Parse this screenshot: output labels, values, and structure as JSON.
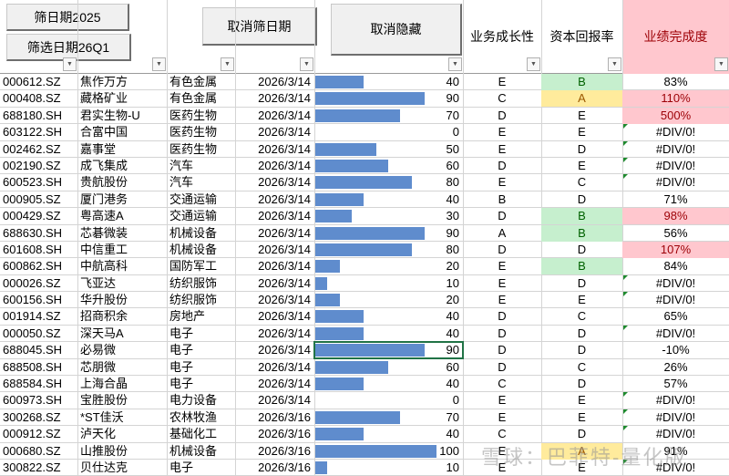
{
  "buttons": {
    "filter_2025": "筛日期2025",
    "filter_26q1": "筛选日期26Q1",
    "cancel_filter": "取消筛日期",
    "unhide": "取消隐藏"
  },
  "headers": {
    "growth": "业务成长性",
    "roe": "资本回报率",
    "completion": "业绩完成度"
  },
  "colors": {
    "bar": "#5f8ccd",
    "good_fill": "#c6efce",
    "good_text": "#006100",
    "neutral_fill": "#ffeb9c",
    "neutral_text": "#9c5700",
    "bad_fill": "#ffc7ce",
    "bad_text": "#9c0006"
  },
  "bar_max": 100,
  "rows": [
    {
      "code": "000612.SZ",
      "name": "焦作万方",
      "industry": "有色金属",
      "date": "2026/3/14",
      "score": 40,
      "growth": "E",
      "roe": "B",
      "roe_style": "good",
      "completion": "83%",
      "comp_style": ""
    },
    {
      "code": "000408.SZ",
      "name": "藏格矿业",
      "industry": "有色金属",
      "date": "2026/3/14",
      "score": 90,
      "growth": "C",
      "roe": "A",
      "roe_style": "neutral",
      "completion": "110%",
      "comp_style": "bad"
    },
    {
      "code": "688180.SH",
      "name": "君实生物-U",
      "industry": "医药生物",
      "date": "2026/3/14",
      "score": 70,
      "growth": "D",
      "roe": "E",
      "roe_style": "",
      "completion": "500%",
      "comp_style": "bad"
    },
    {
      "code": "603122.SH",
      "name": "合富中国",
      "industry": "医药生物",
      "date": "2026/3/14",
      "score": 0,
      "growth": "E",
      "roe": "E",
      "roe_style": "",
      "completion": "#DIV/0!",
      "comp_style": ""
    },
    {
      "code": "002462.SZ",
      "name": "嘉事堂",
      "industry": "医药生物",
      "date": "2026/3/14",
      "score": 50,
      "growth": "E",
      "roe": "D",
      "roe_style": "",
      "completion": "#DIV/0!",
      "comp_style": ""
    },
    {
      "code": "002190.SZ",
      "name": "成飞集成",
      "industry": "汽车",
      "date": "2026/3/14",
      "score": 60,
      "growth": "D",
      "roe": "E",
      "roe_style": "",
      "completion": "#DIV/0!",
      "comp_style": ""
    },
    {
      "code": "600523.SH",
      "name": "贵航股份",
      "industry": "汽车",
      "date": "2026/3/14",
      "score": 80,
      "growth": "E",
      "roe": "C",
      "roe_style": "",
      "completion": "#DIV/0!",
      "comp_style": ""
    },
    {
      "code": "000905.SZ",
      "name": "厦门港务",
      "industry": "交通运输",
      "date": "2026/3/14",
      "score": 40,
      "growth": "B",
      "roe": "D",
      "roe_style": "",
      "completion": "71%",
      "comp_style": ""
    },
    {
      "code": "000429.SZ",
      "name": "粤高速A",
      "industry": "交通运输",
      "date": "2026/3/14",
      "score": 30,
      "growth": "D",
      "roe": "B",
      "roe_style": "good",
      "completion": "98%",
      "comp_style": "bad"
    },
    {
      "code": "688630.SH",
      "name": "芯碁微装",
      "industry": "机械设备",
      "date": "2026/3/14",
      "score": 90,
      "growth": "A",
      "roe": "B",
      "roe_style": "good",
      "completion": "56%",
      "comp_style": ""
    },
    {
      "code": "601608.SH",
      "name": "中信重工",
      "industry": "机械设备",
      "date": "2026/3/14",
      "score": 80,
      "growth": "D",
      "roe": "D",
      "roe_style": "",
      "completion": "107%",
      "comp_style": "bad"
    },
    {
      "code": "600862.SH",
      "name": "中航高科",
      "industry": "国防军工",
      "date": "2026/3/14",
      "score": 20,
      "growth": "E",
      "roe": "B",
      "roe_style": "good",
      "completion": "84%",
      "comp_style": ""
    },
    {
      "code": "000026.SZ",
      "name": "飞亚达",
      "industry": "纺织服饰",
      "date": "2026/3/14",
      "score": 10,
      "growth": "E",
      "roe": "D",
      "roe_style": "",
      "completion": "#DIV/0!",
      "comp_style": ""
    },
    {
      "code": "600156.SH",
      "name": "华升股份",
      "industry": "纺织服饰",
      "date": "2026/3/14",
      "score": 20,
      "growth": "E",
      "roe": "E",
      "roe_style": "",
      "completion": "#DIV/0!",
      "comp_style": ""
    },
    {
      "code": "001914.SZ",
      "name": "招商积余",
      "industry": "房地产",
      "date": "2026/3/14",
      "score": 40,
      "growth": "D",
      "roe": "C",
      "roe_style": "",
      "completion": "65%",
      "comp_style": ""
    },
    {
      "code": "000050.SZ",
      "name": "深天马A",
      "industry": "电子",
      "date": "2026/3/14",
      "score": 40,
      "growth": "D",
      "roe": "D",
      "roe_style": "",
      "completion": "#DIV/0!",
      "comp_style": ""
    },
    {
      "code": "688045.SH",
      "name": "必易微",
      "industry": "电子",
      "date": "2026/3/14",
      "score": 90,
      "growth": "D",
      "roe": "D",
      "roe_style": "",
      "completion": "-10%",
      "comp_style": ""
    },
    {
      "code": "688508.SH",
      "name": "芯朋微",
      "industry": "电子",
      "date": "2026/3/14",
      "score": 60,
      "growth": "D",
      "roe": "C",
      "roe_style": "",
      "completion": "26%",
      "comp_style": ""
    },
    {
      "code": "688584.SH",
      "name": "上海合晶",
      "industry": "电子",
      "date": "2026/3/14",
      "score": 40,
      "growth": "C",
      "roe": "D",
      "roe_style": "",
      "completion": "57%",
      "comp_style": ""
    },
    {
      "code": "600973.SH",
      "name": "宝胜股份",
      "industry": "电力设备",
      "date": "2026/3/14",
      "score": 0,
      "growth": "E",
      "roe": "E",
      "roe_style": "",
      "completion": "#DIV/0!",
      "comp_style": ""
    },
    {
      "code": "300268.SZ",
      "name": "*ST佳沃",
      "industry": "农林牧渔",
      "date": "2026/3/16",
      "score": 70,
      "growth": "E",
      "roe": "E",
      "roe_style": "",
      "completion": "#DIV/0!",
      "comp_style": ""
    },
    {
      "code": "000912.SZ",
      "name": "泸天化",
      "industry": "基础化工",
      "date": "2026/3/16",
      "score": 40,
      "growth": "C",
      "roe": "D",
      "roe_style": "",
      "completion": "#DIV/0!",
      "comp_style": ""
    },
    {
      "code": "000680.SZ",
      "name": "山推股份",
      "industry": "机械设备",
      "date": "2026/3/16",
      "score": 100,
      "growth": "E",
      "roe": "A",
      "roe_style": "neutral",
      "completion": "91%",
      "comp_style": ""
    },
    {
      "code": "300822.SZ",
      "name": "贝仕达克",
      "industry": "电子",
      "date": "2026/3/16",
      "score": 10,
      "growth": "E",
      "roe": "E",
      "roe_style": "",
      "completion": "#DIV/0!",
      "comp_style": ""
    }
  ],
  "watermark": "雪球：巴菲特-量化版"
}
